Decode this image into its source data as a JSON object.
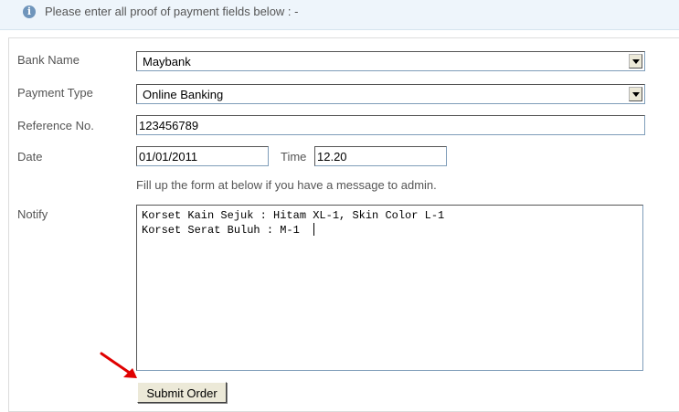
{
  "notice": {
    "text": "Please enter all proof of payment fields below : -",
    "icon": "info-icon"
  },
  "form": {
    "bank_name": {
      "label": "Bank Name",
      "value": "Maybank"
    },
    "payment_type": {
      "label": "Payment Type",
      "value": "Online Banking"
    },
    "reference": {
      "label": "Reference No.",
      "value": "123456789"
    },
    "date": {
      "label": "Date",
      "value": "01/01/2011"
    },
    "time": {
      "label": "Time",
      "value": "12.20"
    },
    "hint": "Fill up the form at below if you have a message to admin.",
    "notify": {
      "label": "Notify",
      "lines": [
        "Korset Kain Sejuk : Hitam XL-1, Skin Color L-1",
        "Korset Serat Buluh : M-1"
      ]
    },
    "submit_label": "Submit Order"
  },
  "colors": {
    "arrow": "#e00000",
    "info_bg": "#eef5fb",
    "button_bg": "#ece9d8"
  }
}
